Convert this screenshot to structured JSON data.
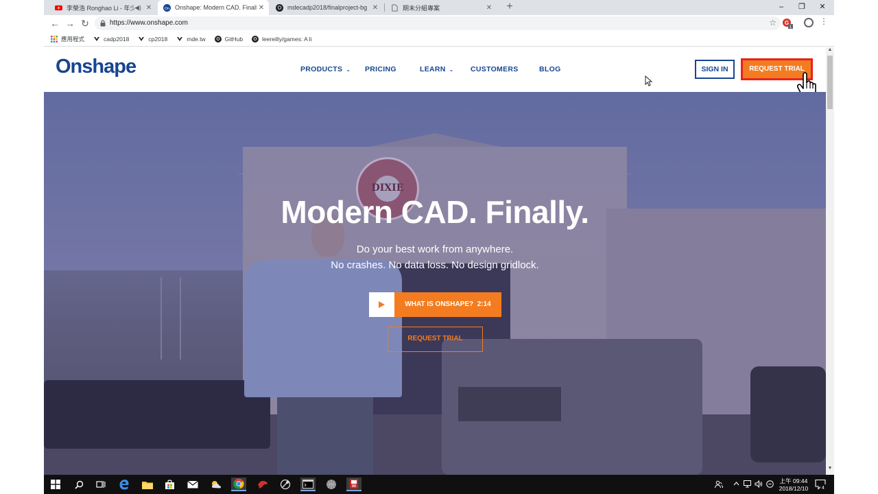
{
  "browser": {
    "tabs": [
      {
        "title": "李榮浩 Ronghao Li - 年少有",
        "icon": "youtube-icon",
        "active": false,
        "audio": true
      },
      {
        "title": "Onshape: Modern CAD. Finally.",
        "icon": "onshape-favicon",
        "active": true,
        "audio": false
      },
      {
        "title": "mdecadp2018/finalproject-bg",
        "icon": "github-icon",
        "active": false,
        "audio": false
      },
      {
        "title": "期末分組專案",
        "icon": "document-icon",
        "active": false,
        "audio": false
      }
    ],
    "url": "https://www.onshape.com",
    "bookmarks": [
      {
        "label": "應用程式",
        "icon": "apps-grid-icon"
      },
      {
        "label": "cadp2018",
        "icon": "bookmark-icon"
      },
      {
        "label": "cp2018",
        "icon": "bookmark-icon"
      },
      {
        "label": "mde.tw",
        "icon": "bookmark-icon"
      },
      {
        "label": "GitHub",
        "icon": "github-icon"
      },
      {
        "label": "leereilly/games: A li",
        "icon": "github-icon"
      }
    ],
    "extension_badge": "1"
  },
  "site": {
    "logo": "Onshape",
    "nav": {
      "products": "PRODUCTS",
      "pricing": "PRICING",
      "learn": "LEARN",
      "customers": "CUSTOMERS",
      "blog": "BLOG"
    },
    "sign_in": "SIGN IN",
    "request_trial": "REQUEST TRIAL"
  },
  "hero": {
    "title": "Modern CAD. Finally.",
    "subtitle_line1": "Do your best work from anywhere.",
    "subtitle_line2": "No crashes. No data loss. No design gridlock.",
    "video_button": "WHAT IS ONSHAPE?",
    "video_duration": "2:14",
    "request_trial": "REQUEST TRIAL",
    "sign_text": "DIXIE"
  },
  "taskbar": {
    "clock_time": "上午 09:44",
    "clock_date": "2018/12/10",
    "notification_count": "4"
  },
  "colors": {
    "brand_blue": "#164591",
    "accent_orange": "#f47c20",
    "highlight_red": "#e8211d"
  }
}
